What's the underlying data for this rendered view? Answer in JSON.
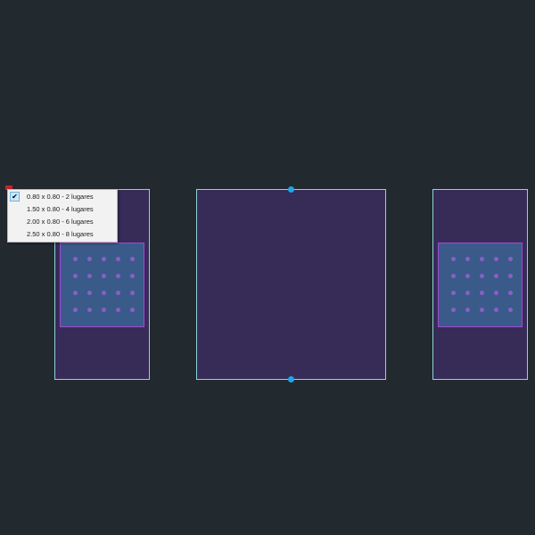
{
  "menu": {
    "items": [
      {
        "label": "0.80 x 0.80 - 2 lugares",
        "checked": true
      },
      {
        "label": "1.50 x 0.80 - 4 lugares",
        "checked": false
      },
      {
        "label": "2.00 x 0.80 - 6 lugares",
        "checked": false
      },
      {
        "label": "2.50 x 0.80 - 8 lugares",
        "checked": false
      }
    ],
    "check_icon": "checkmark-icon"
  },
  "colors": {
    "background": "#222a30",
    "block_fill": "#372c58",
    "block_outline": "#8fd3d6",
    "table_fill": "#3a5a8a",
    "table_outline": "#a04ad4",
    "grip": "#1ea7e8",
    "marker": "#c0262c"
  }
}
